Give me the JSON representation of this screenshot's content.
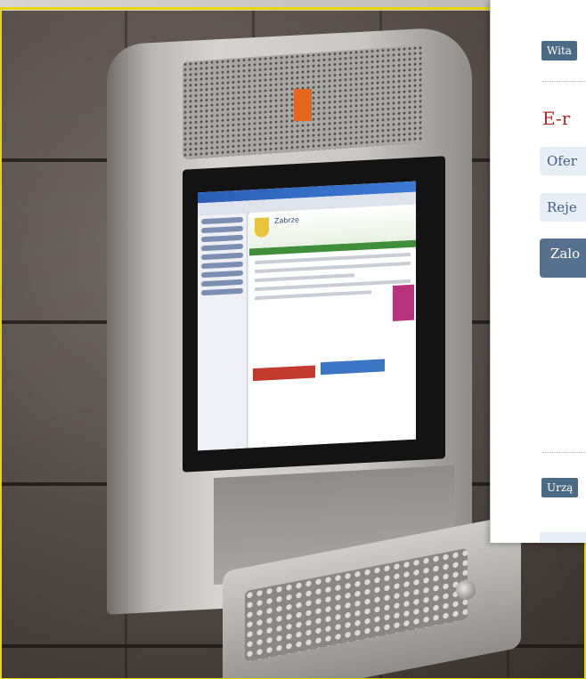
{
  "webpanel": {
    "welcome_btn": "Wita",
    "heading": "E-r",
    "links": [
      {
        "label": "Ofer"
      },
      {
        "label": "Reje"
      }
    ],
    "dark_link": "Zalo",
    "footer_btn": "Urzą"
  },
  "kiosk_screen": {
    "site_title": "Zabrze"
  },
  "colors": {
    "border": "#e9d60e",
    "heading": "#b22a2a",
    "button": "#4a6b86",
    "link_bg": "#e8eef6",
    "accent_orange": "#e5671f"
  }
}
